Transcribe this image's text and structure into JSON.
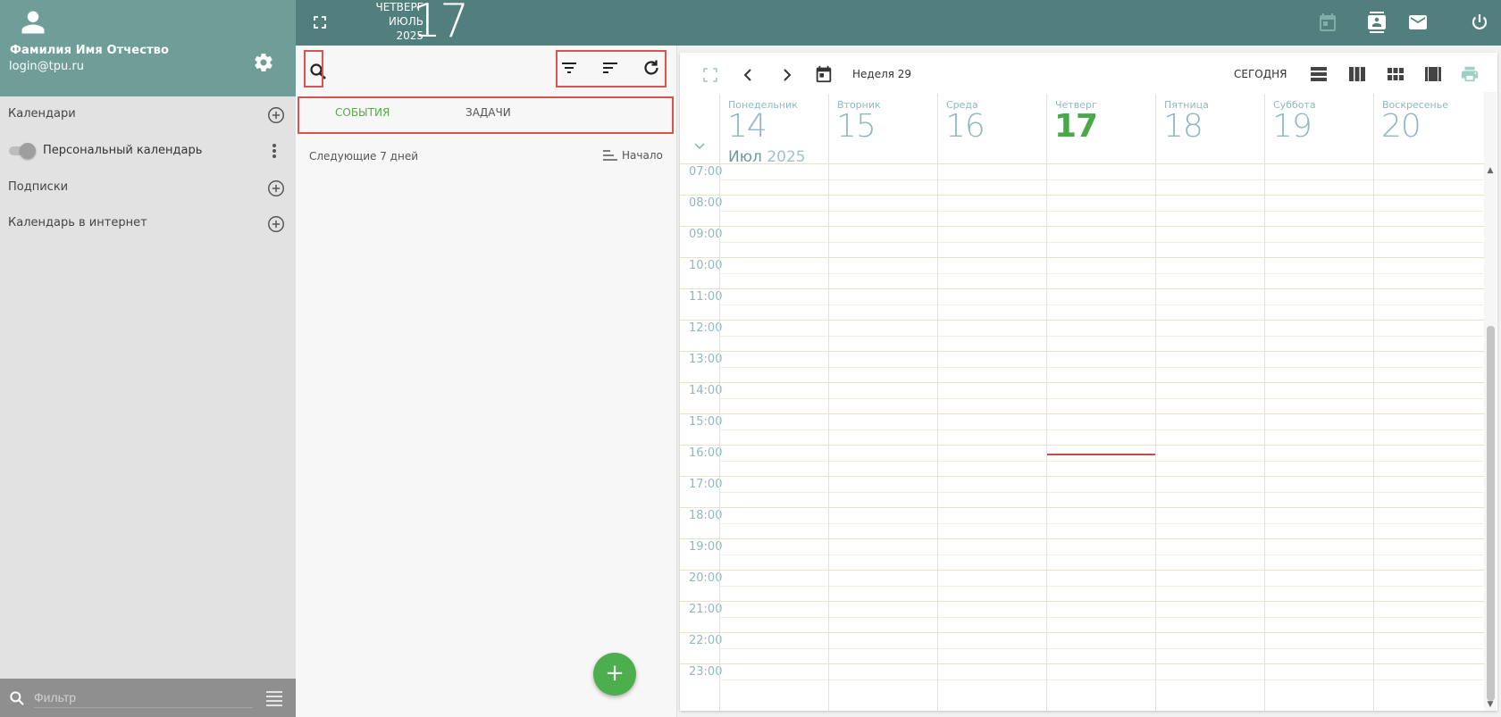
{
  "user": {
    "name": "Фамилия Имя Отчество",
    "email": "login@tpu.ru"
  },
  "sidebar": {
    "calendars_label": "Календари",
    "personal_calendar": "Персональный календарь",
    "subscriptions_label": "Подписки",
    "internet_calendar_label": "Календарь в интернет",
    "filter_placeholder": "Фильтр"
  },
  "topbar": {
    "weekday": "ЧЕТВЕРГ",
    "month": "ИЮЛЬ",
    "year": "2025",
    "day": "17"
  },
  "events_panel": {
    "tabs": {
      "events": "СОБЫТИЯ",
      "tasks": "ЗАДАЧИ"
    },
    "range_label": "Следующие 7 дней",
    "sort_label": "Начало",
    "fab_label": "+"
  },
  "calendar": {
    "week_label": "Неделя 29",
    "today_button": "СЕГОДНЯ",
    "month": "Июл",
    "year": "2025",
    "days": [
      {
        "name": "Понедельник",
        "num": "14"
      },
      {
        "name": "Вторник",
        "num": "15"
      },
      {
        "name": "Среда",
        "num": "16"
      },
      {
        "name": "Четверг",
        "num": "17",
        "today": true
      },
      {
        "name": "Пятница",
        "num": "18"
      },
      {
        "name": "Суббота",
        "num": "19"
      },
      {
        "name": "Воскресенье",
        "num": "20"
      }
    ],
    "hours": [
      "07:00",
      "08:00",
      "09:00",
      "10:00",
      "11:00",
      "12:00",
      "13:00",
      "14:00",
      "15:00",
      "16:00",
      "17:00",
      "18:00",
      "19:00",
      "20:00",
      "21:00",
      "22:00",
      "23:00"
    ]
  },
  "colors": {
    "header": "#507f7d",
    "profile": "#6e9e97",
    "accent": "#4cae4c",
    "now_line": "#c84b4b"
  }
}
